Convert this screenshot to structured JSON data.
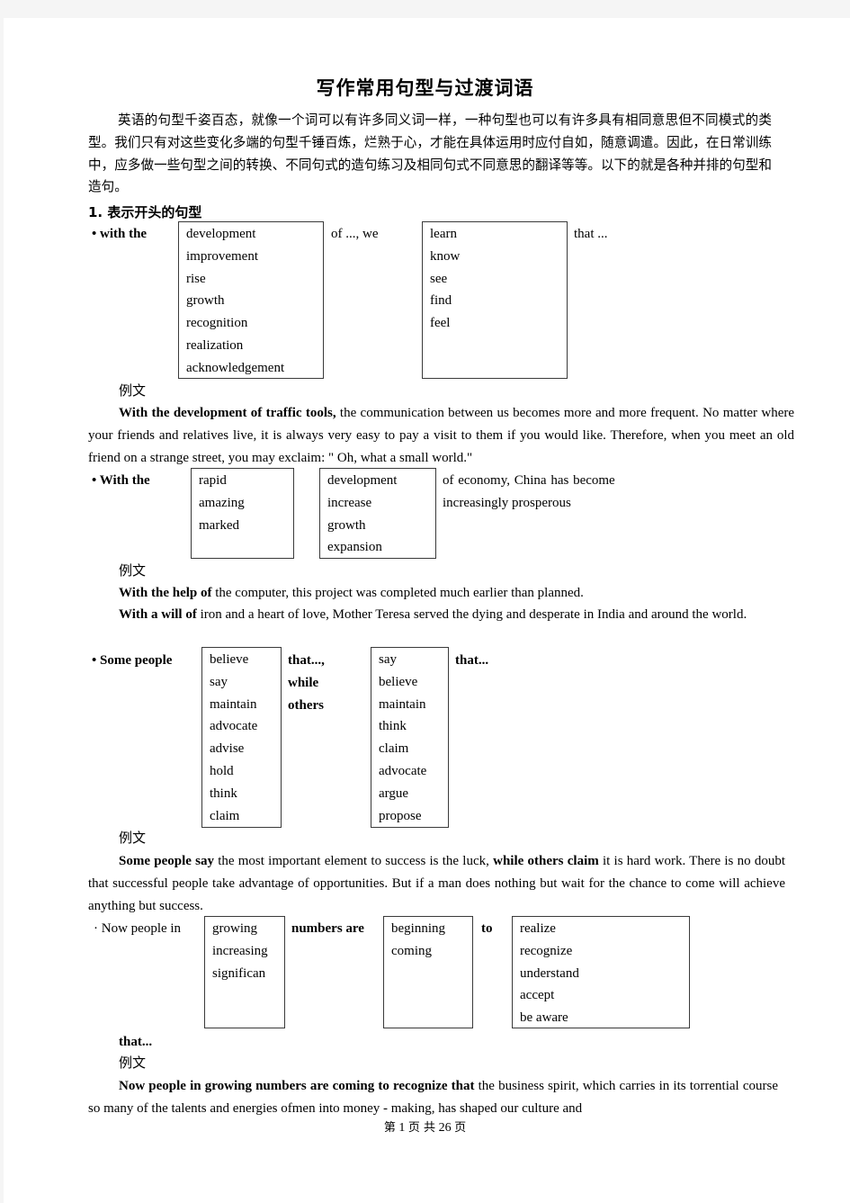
{
  "title": "写作常用句型与过渡词语",
  "intro": "英语的句型千姿百态，就像一个词可以有许多同义词一样，一种句型也可以有许多具有相同意思但不同模式的类型。我们只有对这些变化多端的句型千锤百炼，烂熟于心，才能在具体运用时应付自如，随意调遣。因此，在日常训练中，应多做一些句型之间的转换、不同句式的造句练习及相同句式不同意思的翻译等等。以下的就是各种并排的句型和造句。",
  "section1": {
    "heading": "1. 表示开头的句型"
  },
  "example_label": "例文",
  "pattern1": {
    "lead": "• with  the",
    "box1": [
      "development",
      "improvement",
      "rise",
      "growth",
      "recognition",
      "realization",
      "acknowledgement"
    ],
    "mid": "of  ...,  we",
    "box2": [
      "learn",
      "know",
      "see",
      "find",
      "feel"
    ],
    "tail": "that  ...",
    "example": {
      "bold": "With the development of traffic tools,",
      "text": " the communication between us becomes more and more frequent. No matter where your friends and relatives live, it is always very easy to pay a visit to them if you would like. Therefore, when you meet an old friend on a strange street, you may exclaim: \" Oh, what a small world.\""
    }
  },
  "pattern2": {
    "lead": "• With  the",
    "box1": [
      "rapid",
      "amazing",
      "marked"
    ],
    "box2": [
      "development",
      "increase",
      "growth",
      "expansion"
    ],
    "tail_line1": "of  economy,  China  has  become",
    "tail_line2": "increasingly  prosperous",
    "examples": [
      {
        "bold": "With the help of",
        "text": " the computer, this project was completed much earlier than planned."
      },
      {
        "bold": "With a will of",
        "text": " iron and a heart of love, Mother Teresa served the dying and desperate in India and around the world."
      }
    ]
  },
  "pattern3": {
    "lead": "• Some  people",
    "box1": [
      "believe",
      "say",
      "maintain",
      "advocate",
      "advise",
      "hold",
      "think",
      "claim"
    ],
    "mid": [
      "that...,",
      "while",
      "others"
    ],
    "box2": [
      "say",
      "believe",
      "maintain",
      "think",
      "claim",
      "advocate",
      "argue",
      "propose"
    ],
    "tail": "that...",
    "example": {
      "bold1": "Some people say",
      "text1": " the most important element to success is the luck, ",
      "bold2": "while others claim",
      "text2": " it is hard work. There is no doubt that successful people take advantage of opportunities. But if a man does nothing but wait for the chance to come will achieve anything but success."
    }
  },
  "pattern4": {
    "lead": "· Now  people  in",
    "box1": [
      "growing",
      "increasing",
      "significan"
    ],
    "mid": "numbers  are",
    "box2": [
      "beginning",
      "coming"
    ],
    "to": "to",
    "box3": [
      "realize",
      "recognize",
      "understand",
      "accept",
      "be  aware"
    ],
    "tail": "that...",
    "example": {
      "bold": "Now people in growing numbers are coming to recognize that",
      "text": " the business spirit, which carries in its torrential course so many of the talents and energies ofmen into money - making, has shaped our culture and"
    }
  },
  "footer": {
    "prefix": "第",
    "page": "1",
    "mid": "页 共",
    "total": "26",
    "suffix": "页"
  }
}
